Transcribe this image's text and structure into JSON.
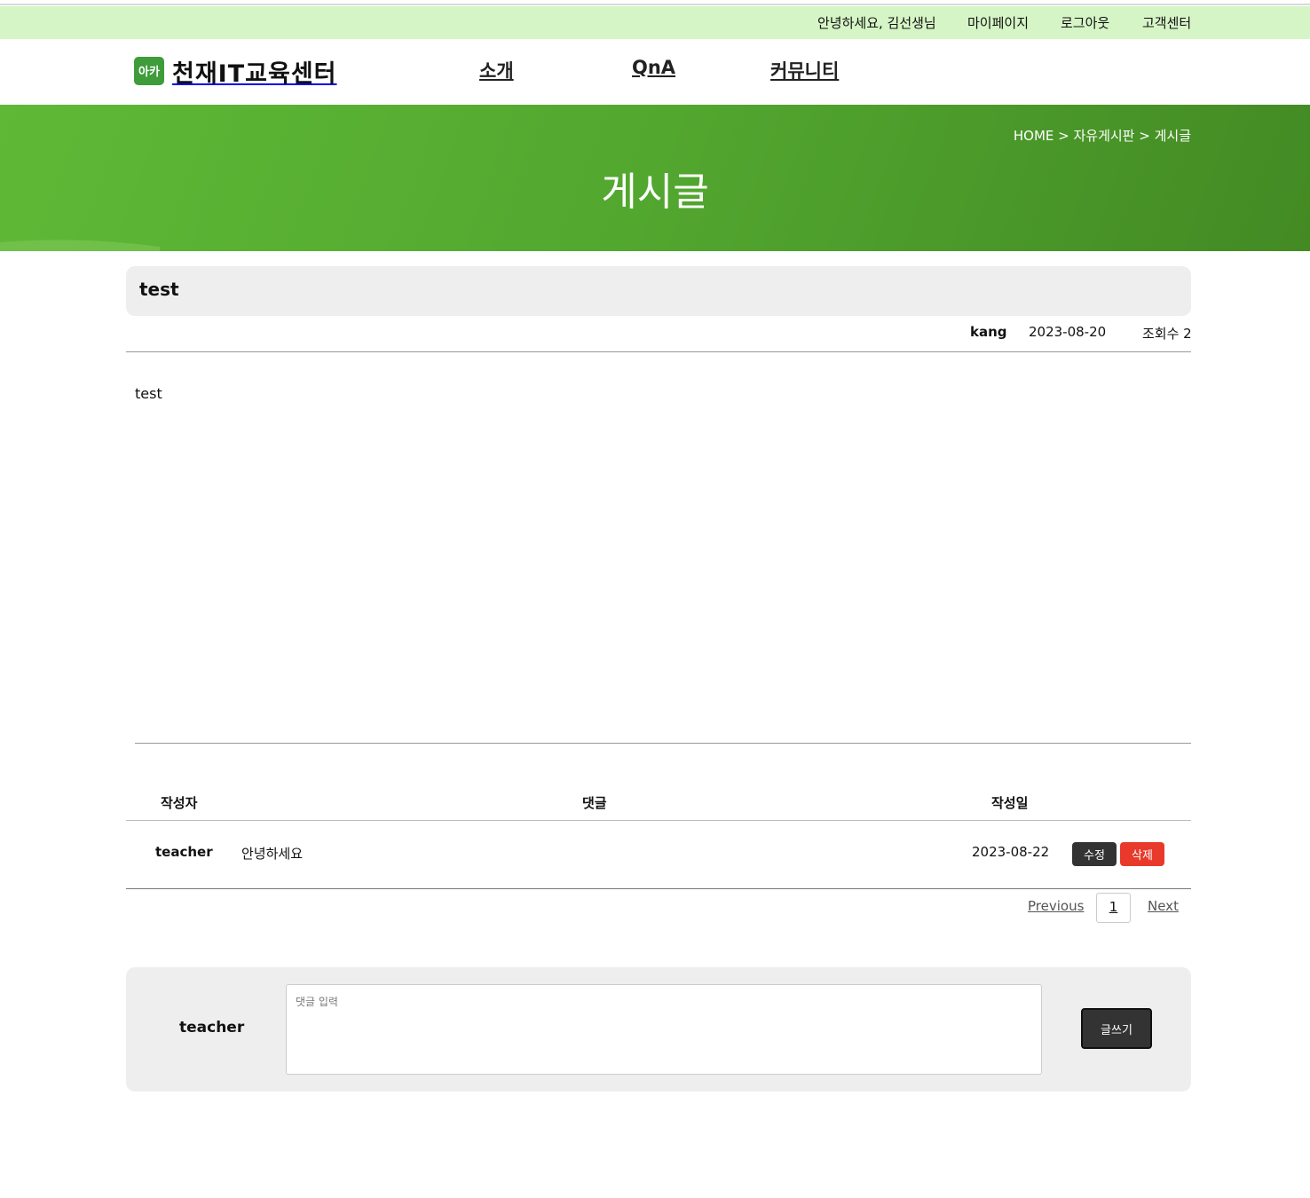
{
  "utility": {
    "greeting": "안녕하세요, 김선생님",
    "mypage": "마이페이지",
    "logout": "로그아웃",
    "support": "고객센터"
  },
  "header": {
    "logo_text": "천재IT교육센터",
    "logo_mark": "아카",
    "nav": [
      "소개",
      "QnA",
      "커뮤니티"
    ]
  },
  "banner": {
    "breadcrumb": "HOME > 자유게시판 > 게시글",
    "title": "게시글"
  },
  "post": {
    "title": "test",
    "author": "kang",
    "date": "2023-08-20",
    "views": "조회수 2",
    "body": "test"
  },
  "comments": {
    "headers": {
      "author": "작성자",
      "comment": "댓글",
      "date": "작성일"
    },
    "rows": [
      {
        "author": "teacher",
        "text": "안녕하세요",
        "date": "2023-08-22",
        "edit_label": "수정",
        "delete_label": "삭제"
      }
    ]
  },
  "pagination": {
    "prev": "Previous",
    "page": "1",
    "next": "Next"
  },
  "comment_form": {
    "user": "teacher",
    "placeholder": "댓글 입력",
    "submit": "글쓰기"
  },
  "colors": {
    "utility_bg": "#d6f5c6",
    "banner": "#52a72f",
    "delete": "#e8392b",
    "dark_button": "#333333"
  }
}
